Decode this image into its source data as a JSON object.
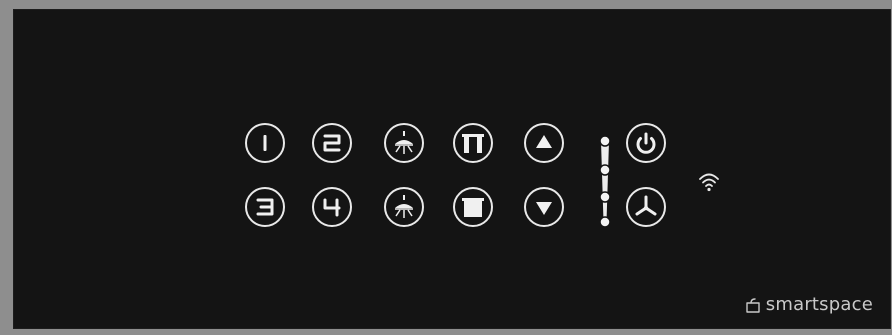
{
  "panel": {
    "buttons": [
      {
        "name": "speed-1-button",
        "icon": "speed-1-icon"
      },
      {
        "name": "speed-2-button",
        "icon": "speed-2-icon"
      },
      {
        "name": "light-button-top",
        "icon": "light-icon"
      },
      {
        "name": "curtain-open-button",
        "icon": "curtain-open-icon"
      },
      {
        "name": "up-arrow-button",
        "icon": "up-arrow-icon"
      },
      {
        "name": "power-button",
        "icon": "power-icon"
      },
      {
        "name": "speed-3-button",
        "icon": "speed-3-icon"
      },
      {
        "name": "speed-4-button",
        "icon": "speed-4-icon"
      },
      {
        "name": "light-button-bottom",
        "icon": "light-icon"
      },
      {
        "name": "curtain-close-button",
        "icon": "curtain-close-icon"
      },
      {
        "name": "down-arrow-button",
        "icon": "down-arrow-icon"
      },
      {
        "name": "fan-button",
        "icon": "fan-icon"
      }
    ],
    "slider": {
      "levels": 4
    },
    "wifi_icon": "wifi-icon",
    "brand": {
      "text": "smartspace",
      "icon": "smartspace-logo-icon"
    },
    "colors": {
      "background": "#141414",
      "frame": "#8e8e8e",
      "accent": "#f0f0f0",
      "brand_text": "#c9c9c9"
    }
  }
}
